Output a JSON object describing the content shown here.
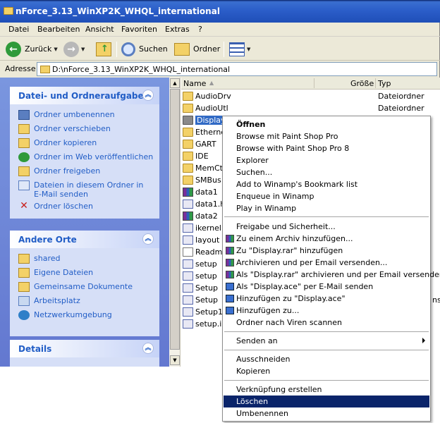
{
  "window": {
    "title": "nForce_3.13_WinXP2K_WHQL_international"
  },
  "menu": [
    "Datei",
    "Bearbeiten",
    "Ansicht",
    "Favoriten",
    "Extras",
    "?"
  ],
  "toolbar": {
    "back": "Zurück",
    "search": "Suchen",
    "folders": "Ordner"
  },
  "address": {
    "label": "Adresse",
    "value": "D:\\nForce_3.13_WinXP2K_WHQL_international"
  },
  "tasks": {
    "file_tasks": {
      "title": "Datei- und Ordneraufgaben",
      "items": [
        "Ordner umbenennen",
        "Ordner verschieben",
        "Ordner kopieren",
        "Ordner im Web veröffentlichen",
        "Ordner freigeben",
        "Dateien in diesem Ordner in E-Mail senden",
        "Ordner löschen"
      ]
    },
    "other_places": {
      "title": "Andere Orte",
      "items": [
        "shared",
        "Eigene Dateien",
        "Gemeinsame Dokumente",
        "Arbeitsplatz",
        "Netzwerkumgebung"
      ]
    },
    "details": {
      "title": "Details"
    }
  },
  "list": {
    "columns": {
      "name": "Name",
      "size": "Größe",
      "type": "Typ"
    },
    "rows": [
      {
        "name": "AudioDrv",
        "type": "Dateiordner",
        "icon": "folder-icon"
      },
      {
        "name": "AudioUtl",
        "type": "Dateiordner",
        "icon": "folder-icon"
      },
      {
        "name": "Display",
        "type": "",
        "icon": "folder-icon",
        "selected": true
      },
      {
        "name": "Etherne",
        "type": "",
        "icon": "folder-icon"
      },
      {
        "name": "GART",
        "type": "",
        "icon": "folder-icon"
      },
      {
        "name": "IDE",
        "type": "",
        "icon": "folder-icon"
      },
      {
        "name": "MemCtl",
        "type": "",
        "icon": "folder-icon"
      },
      {
        "name": "SMBus",
        "type": "",
        "icon": "folder-icon"
      },
      {
        "name": "data1",
        "type": "",
        "icon": "rar-icon"
      },
      {
        "name": "data1.h",
        "type": "",
        "icon": "exe-icon"
      },
      {
        "name": "data2",
        "type": "",
        "icon": "rar-icon"
      },
      {
        "name": "ikernel",
        "type": "",
        "icon": "exe-icon"
      },
      {
        "name": "layout",
        "type": "",
        "icon": "exe-icon"
      },
      {
        "name": "Readme",
        "type": "",
        "icon": "doc-icon"
      },
      {
        "name": "setup",
        "type": "",
        "icon": "exe-icon"
      },
      {
        "name": "setup",
        "type": "",
        "icon": "exe-icon"
      },
      {
        "name": "Setup",
        "type": "",
        "icon": "exe-icon"
      },
      {
        "name": "Setup",
        "type": "",
        "icon": "exe-icon"
      },
      {
        "name": "Setup16",
        "type": "",
        "icon": "exe-icon"
      },
      {
        "name": "setup.is",
        "type": "",
        "icon": "exe-icon"
      }
    ],
    "partial_type_text": "ns"
  },
  "context_menu": {
    "items": [
      {
        "label": "Öffnen",
        "bold": true
      },
      {
        "label": "Browse mit Paint Shop Pro"
      },
      {
        "label": "Browse with Paint Shop Pro 8"
      },
      {
        "label": "Explorer"
      },
      {
        "label": "Suchen..."
      },
      {
        "label": "Add to Winamp's Bookmark list"
      },
      {
        "label": "Enqueue in Winamp"
      },
      {
        "label": "Play in Winamp"
      },
      {
        "sep": true
      },
      {
        "label": "Freigabe und Sicherheit..."
      },
      {
        "label": "Zu einem Archiv hinzufügen...",
        "icon": "rar-icon"
      },
      {
        "label": "Zu \"Display.rar\" hinzufügen",
        "icon": "rar-icon"
      },
      {
        "label": "Archivieren und per Email versenden...",
        "icon": "rar-icon"
      },
      {
        "label": "Als \"Display.rar\" archivieren und per Email versenden",
        "icon": "rar-icon"
      },
      {
        "label": "Als \"Display.ace\" per E-Mail senden",
        "icon": "ace-icon"
      },
      {
        "label": "Hinzufügen zu \"Display.ace\"",
        "icon": "ace-icon"
      },
      {
        "label": "Hinzufügen zu...",
        "icon": "ace-icon"
      },
      {
        "label": "Ordner nach Viren scannen"
      },
      {
        "sep": true
      },
      {
        "label": "Senden an",
        "submenu": true
      },
      {
        "sep": true
      },
      {
        "label": "Ausschneiden"
      },
      {
        "label": "Kopieren"
      },
      {
        "sep": true
      },
      {
        "label": "Verknüpfung erstellen"
      },
      {
        "label": "Löschen",
        "highlighted": true
      },
      {
        "label": "Umbenennen"
      }
    ]
  }
}
